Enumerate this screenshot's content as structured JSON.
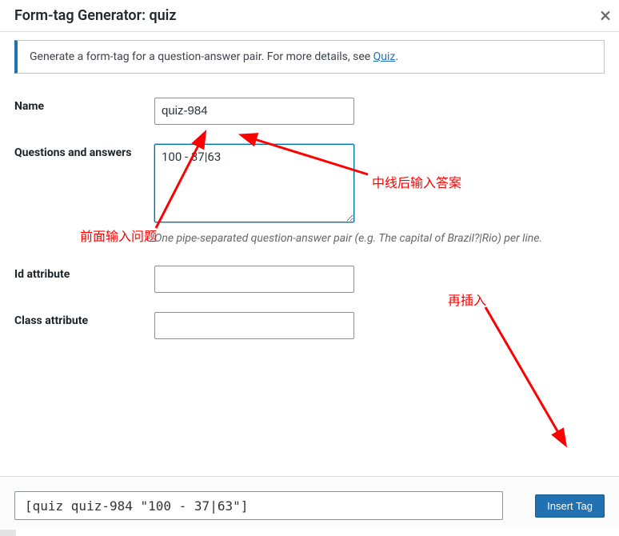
{
  "header": {
    "title": "Form-tag Generator: quiz",
    "close_glyph": "×"
  },
  "info": {
    "prefix": "Generate a form-tag for a question-answer pair. For more details, see ",
    "link": "Quiz",
    "suffix": "."
  },
  "fields": {
    "name": {
      "label": "Name",
      "value": "quiz-984"
    },
    "qa": {
      "label": "Questions and answers",
      "value": "100 - 37|63",
      "hint": "One pipe-separated question-answer pair (e.g. The capital of Brazil?|Rio) per line."
    },
    "id": {
      "label": "Id attribute",
      "value": ""
    },
    "class": {
      "label": "Class attribute",
      "value": ""
    }
  },
  "footer": {
    "code": "[quiz quiz-984 \"100 - 37|63\"]",
    "button": "Insert Tag"
  },
  "annotations": {
    "a1": "中线后输入答案",
    "a2": "前面输入问题",
    "a3": "再插入"
  }
}
